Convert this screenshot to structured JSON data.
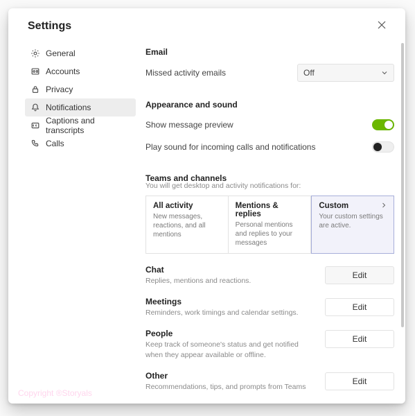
{
  "window": {
    "title": "Settings"
  },
  "sidebar": {
    "items": [
      {
        "label": "General"
      },
      {
        "label": "Accounts"
      },
      {
        "label": "Privacy"
      },
      {
        "label": "Notifications"
      },
      {
        "label": "Captions and transcripts"
      },
      {
        "label": "Calls"
      }
    ],
    "active_index": 3
  },
  "sections": {
    "email": {
      "heading": "Email",
      "missed_label": "Missed activity emails",
      "missed_value": "Off"
    },
    "appearance": {
      "heading": "Appearance and sound",
      "preview_label": "Show message preview",
      "preview_on": true,
      "sound_label": "Play sound for incoming calls and notifications",
      "sound_on": false
    },
    "teams": {
      "heading": "Teams and channels",
      "subtext": "You will get desktop and activity notifications for:",
      "cards": [
        {
          "title": "All activity",
          "desc": "New messages, reactions, and all mentions"
        },
        {
          "title": "Mentions & replies",
          "desc": "Personal mentions and replies to your messages"
        },
        {
          "title": "Custom",
          "desc": "Your custom settings are active."
        }
      ],
      "active_card": 2
    },
    "chat": {
      "heading": "Chat",
      "desc": "Replies, mentions and reactions.",
      "button": "Edit"
    },
    "meetings": {
      "heading": "Meetings",
      "desc": "Reminders, work timings and calendar settings.",
      "button": "Edit"
    },
    "people": {
      "heading": "People",
      "desc": "Keep track of someone's status and get notified when they appear available or offline.",
      "button": "Edit"
    },
    "other": {
      "heading": "Other",
      "desc": "Recommendations, tips, and prompts from Teams",
      "button": "Edit"
    }
  },
  "watermark": "Copyright ®Storyals"
}
